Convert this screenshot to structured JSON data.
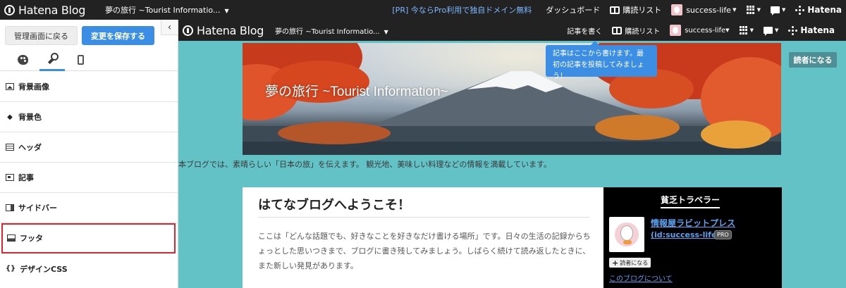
{
  "topbar": {
    "logo": "Hatena Blog",
    "blog_name": "夢の旅行  ~Tourist Informatio...",
    "pr_link": "[PR] 今ならPro利用で独自ドメイン無料",
    "dashboard": "ダッシュボード",
    "reading_list": "購読リスト",
    "user": "success-life",
    "hatena": "Hatena"
  },
  "panel": {
    "back_button": "管理画面に戻る",
    "save_button": "変更を保存する",
    "collapse": "‹",
    "menu": [
      {
        "label": "背景画像"
      },
      {
        "label": "背景色"
      },
      {
        "label": "ヘッダ"
      },
      {
        "label": "記事"
      },
      {
        "label": "サイドバー"
      },
      {
        "label": "フッタ"
      },
      {
        "label": "デザインCSS"
      }
    ]
  },
  "preview": {
    "bar": {
      "logo": "Hatena Blog",
      "blog_name": "夢の旅行  ~Tourist Informatio...",
      "write": "記事を書く",
      "reading_list": "購読リスト",
      "user": "success-life",
      "hatena": "Hatena"
    },
    "tooltip": "記事はここから書けます。最初の記事を投稿してみましょう！",
    "subscribe": "読者になる",
    "hero_title": "夢の旅行 ~Tourist Information~",
    "description": "本ブログでは、素晴らしい「日本の旅」を伝えます。 観光地、美味しい料理などの情報を満載しています。",
    "article": {
      "title": "はてなブログへようこそ！",
      "body": "ここは「どんな話題でも、好きなことを好きなだけ書ける場所」です。日々の生活の記録からちょっとした思いつきまで、ブログに書き残してみましょう。しばらく続けて読み返したときに、また新しい発見があります。"
    },
    "sidebar": {
      "title": "貧乏トラベラー",
      "name": "情報屋ラビットプレス",
      "id": "(id:success-life)",
      "pro": "PRO",
      "follow": "読者になる",
      "about": "このブログについて"
    }
  },
  "colors": {
    "accent": "#3c8ee5",
    "preview_bg": "#63c2c6",
    "highlight": "#e3232d"
  },
  "chart_data": {
    "type": "table",
    "rows": []
  }
}
